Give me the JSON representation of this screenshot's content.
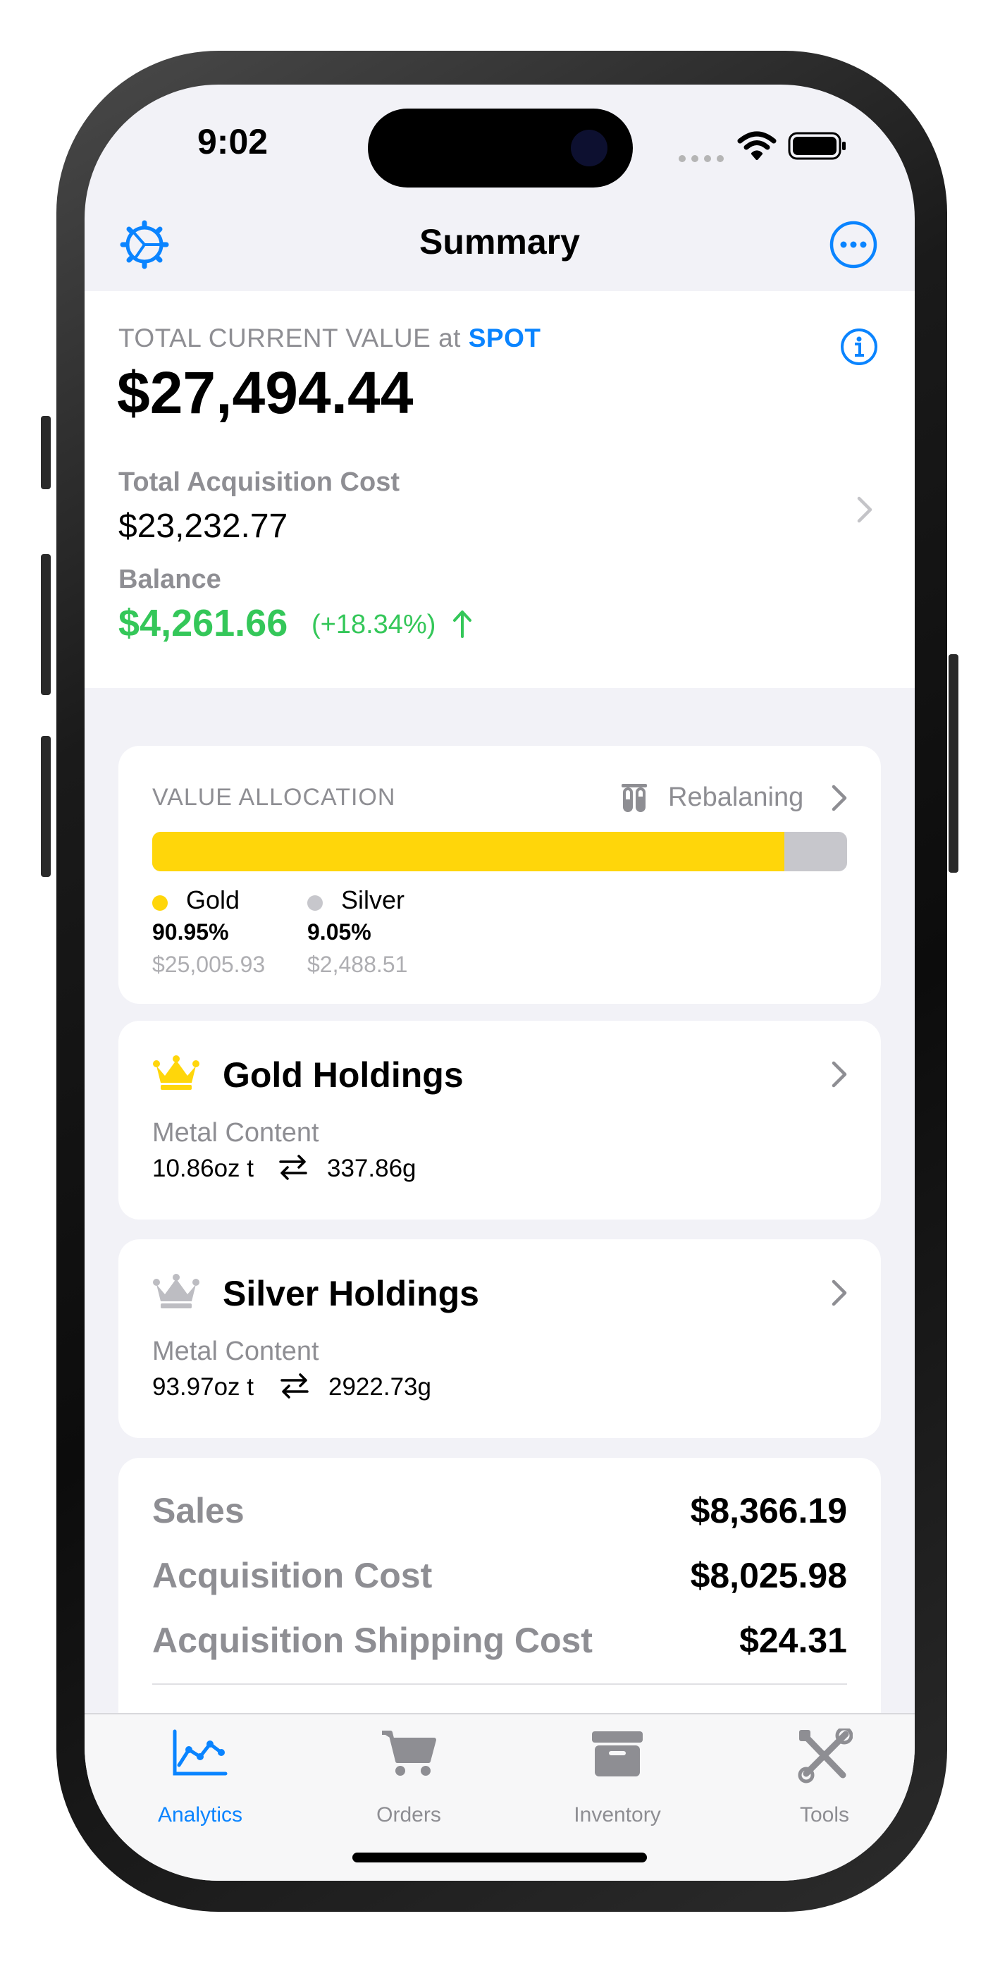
{
  "status_bar": {
    "time": "9:02"
  },
  "nav": {
    "title": "Summary",
    "settings_icon": "settings-gear-icon",
    "more_icon": "more-ellipsis-icon"
  },
  "summary": {
    "total_label": "TOTAL CURRENT VALUE at",
    "spot_label": "SPOT",
    "total_value": "$27,494.44",
    "acq_label": "Total Acquisition Cost",
    "acq_value": "$23,232.77",
    "balance_label": "Balance",
    "balance_value": "$4,261.66",
    "balance_pct": "(+18.34%)"
  },
  "allocation": {
    "title": "VALUE ALLOCATION",
    "rebalance_label": "Rebalaning",
    "gold_fraction": 0.9095,
    "items": [
      {
        "name": "Gold",
        "pct": "90.95%",
        "value": "$25,005.93",
        "color": "#FFD60A"
      },
      {
        "name": "Silver",
        "pct": "9.05%",
        "value": "$2,488.51",
        "color": "#C7C7CC"
      }
    ]
  },
  "gold_holdings": {
    "title": "Gold Holdings",
    "content_label": "Metal Content",
    "oz": "10.86oz t",
    "grams": "337.86g",
    "icon": "crown-icon",
    "color": "#FFD60A"
  },
  "silver_holdings": {
    "title": "Silver Holdings",
    "content_label": "Metal Content",
    "oz": "93.97oz t",
    "grams": "2922.73g",
    "icon": "crown-icon",
    "color": "#BDBDC2"
  },
  "totals": [
    {
      "label": "Sales",
      "value": "$8,366.19"
    },
    {
      "label": "Acquisition Cost",
      "value": "$8,025.98"
    },
    {
      "label": "Acquisition Shipping Cost",
      "value": "$24.31"
    }
  ],
  "tabs": [
    {
      "label": "Analytics",
      "icon": "chart-line-icon",
      "active": true
    },
    {
      "label": "Orders",
      "icon": "cart-icon",
      "active": false
    },
    {
      "label": "Inventory",
      "icon": "archive-box-icon",
      "active": false
    },
    {
      "label": "Tools",
      "icon": "tools-icon",
      "active": false
    }
  ],
  "colors": {
    "accent": "#0A84FF",
    "positive": "#34C759",
    "gray": "#8E8E93",
    "background": "#F2F2F7"
  }
}
